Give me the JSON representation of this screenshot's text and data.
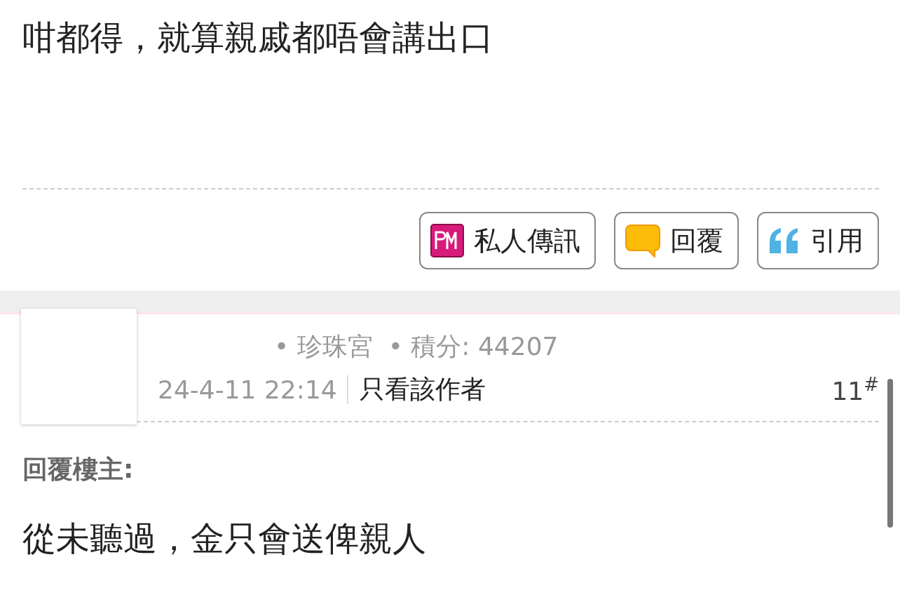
{
  "previous_post": {
    "body": "咁都得，就算親戚都唔會講出口",
    "actions": [
      {
        "kind": "pm",
        "label": "私人傳訊"
      },
      {
        "kind": "reply",
        "label": "回覆"
      },
      {
        "kind": "quote",
        "label": "引用"
      }
    ]
  },
  "post": {
    "meta": [
      "• 珍珠宮",
      "• 積分: 44207"
    ],
    "time": "24-4-11 22:14",
    "author_only": "只看該作者",
    "floor": "11$^{#}$",
    "reply_to": "回覆樓主:",
    "body": "從未聽過，金只會送俾親人"
  }
}
